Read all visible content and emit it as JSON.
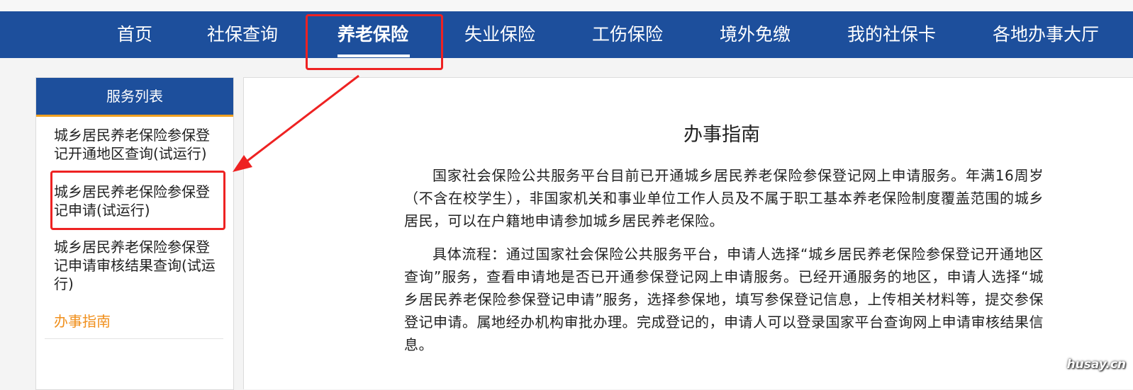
{
  "nav": {
    "items": [
      {
        "label": "首页"
      },
      {
        "label": "社保查询"
      },
      {
        "label": "养老保险"
      },
      {
        "label": "失业保险"
      },
      {
        "label": "工伤保险"
      },
      {
        "label": "境外免缴"
      },
      {
        "label": "我的社保卡"
      },
      {
        "label": "各地办事大厅"
      }
    ],
    "active": "养老保险"
  },
  "sidebar": {
    "header": "服务列表",
    "items": [
      {
        "label": "城乡居民养老保险参保登记开通地区查询(试运行)"
      },
      {
        "label": "城乡居民养老保险参保登记申请(试运行)"
      },
      {
        "label": "城乡居民养老保险参保登记申请审核结果查询(试运行)"
      },
      {
        "label": "办事指南"
      }
    ],
    "current": "办事指南"
  },
  "main": {
    "title": "办事指南",
    "paragraphs": [
      "国家社会保险公共服务平台目前已开通城乡居民养老保险参保登记网上申请服务。年满16周岁（不含在校学生），非国家机关和事业单位工作人员及不属于职工基本养老保险制度覆盖范围的城乡居民，可以在户籍地申请参加城乡居民养老保险。",
      "具体流程：通过国家社会保险公共服务平台，申请人选择“城乡居民养老保险参保登记开通地区查询”服务，查看申请地是否已开通参保登记网上申请服务。已经开通服务的地区，申请人选择“城乡居民养老保险参保登记申请”服务，选择参保地，填写参保登记信息，上传相关材料等，提交参保登记申请。属地经办机构审批办理。完成登记的，申请人可以登录国家平台查询网上申请审核结果信息。"
    ]
  },
  "watermark": "husay.cn",
  "colors": {
    "nav_bg": "#1d4f9c",
    "accent_orange": "#f08f1c",
    "annotation_red": "#ee2222"
  }
}
